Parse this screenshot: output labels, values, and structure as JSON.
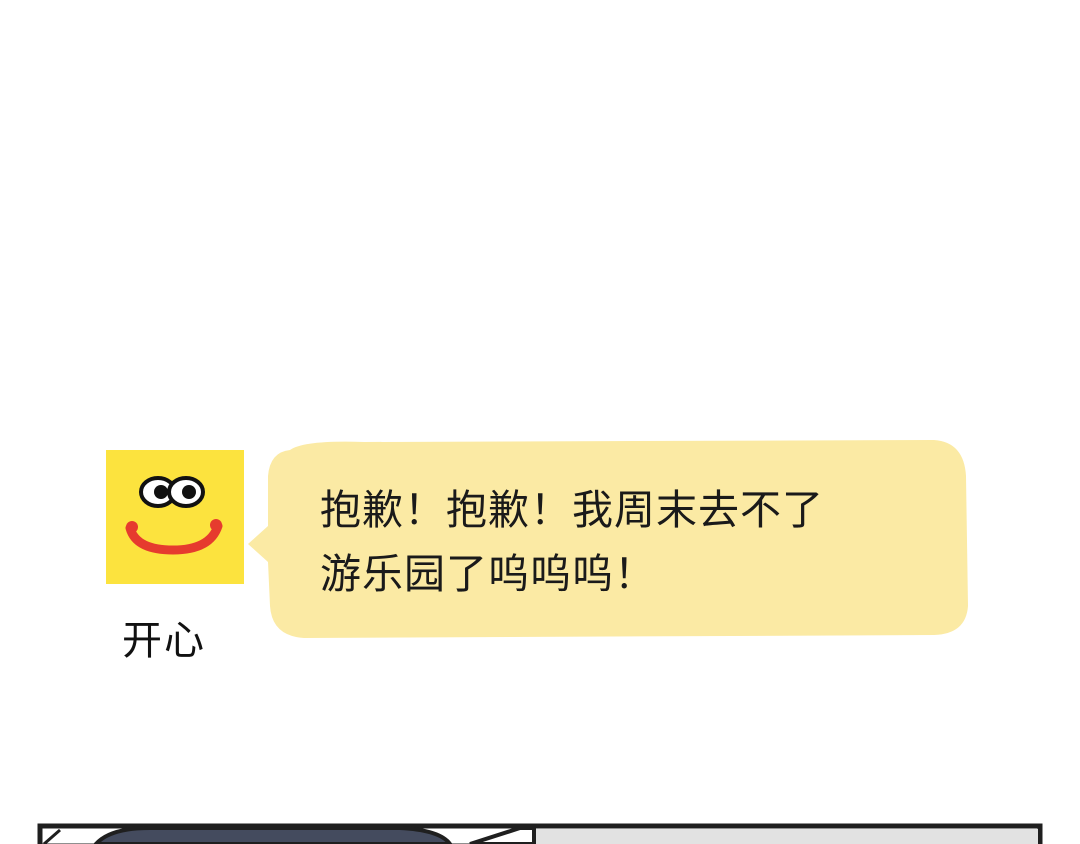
{
  "message": {
    "sender": "开心",
    "avatar_icon": "smiley-face-icon",
    "lines": [
      "抱歉！抱歉！我周末去不了",
      "游乐园了呜呜呜！"
    ]
  },
  "colors": {
    "avatar_bg": "#FCE33E",
    "smile": "#E63B2E",
    "bubble": "#FBEAA4",
    "next_panel_frame": "#1F1F1F",
    "next_panel_fill": "#444B5E",
    "next_panel_gray": "#E2E2E2"
  }
}
